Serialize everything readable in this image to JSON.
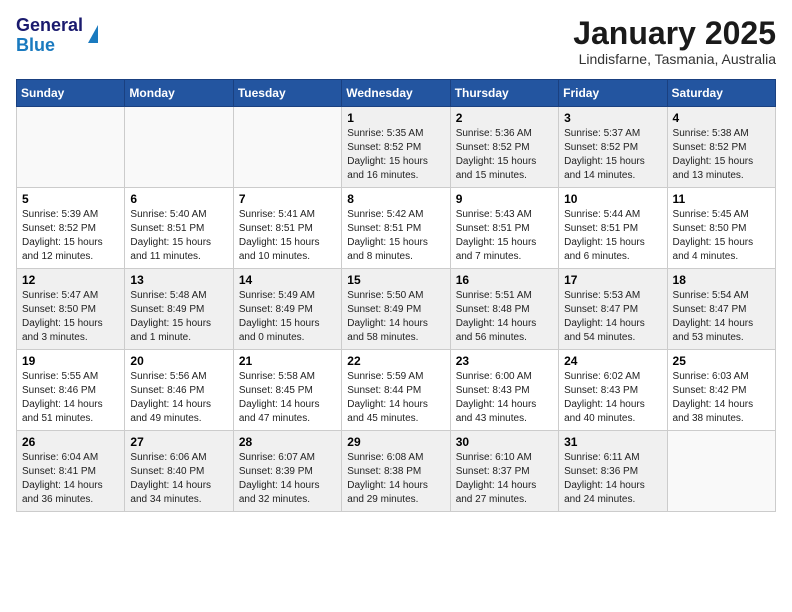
{
  "header": {
    "logo_line1": "General",
    "logo_line2": "Blue",
    "title": "January 2025",
    "subtitle": "Lindisfarne, Tasmania, Australia"
  },
  "days_of_week": [
    "Sunday",
    "Monday",
    "Tuesday",
    "Wednesday",
    "Thursday",
    "Friday",
    "Saturday"
  ],
  "weeks": [
    [
      {
        "num": "",
        "sunrise": "",
        "sunset": "",
        "daylight": ""
      },
      {
        "num": "",
        "sunrise": "",
        "sunset": "",
        "daylight": ""
      },
      {
        "num": "",
        "sunrise": "",
        "sunset": "",
        "daylight": ""
      },
      {
        "num": "1",
        "sunrise": "Sunrise: 5:35 AM",
        "sunset": "Sunset: 8:52 PM",
        "daylight": "Daylight: 15 hours and 16 minutes."
      },
      {
        "num": "2",
        "sunrise": "Sunrise: 5:36 AM",
        "sunset": "Sunset: 8:52 PM",
        "daylight": "Daylight: 15 hours and 15 minutes."
      },
      {
        "num": "3",
        "sunrise": "Sunrise: 5:37 AM",
        "sunset": "Sunset: 8:52 PM",
        "daylight": "Daylight: 15 hours and 14 minutes."
      },
      {
        "num": "4",
        "sunrise": "Sunrise: 5:38 AM",
        "sunset": "Sunset: 8:52 PM",
        "daylight": "Daylight: 15 hours and 13 minutes."
      }
    ],
    [
      {
        "num": "5",
        "sunrise": "Sunrise: 5:39 AM",
        "sunset": "Sunset: 8:52 PM",
        "daylight": "Daylight: 15 hours and 12 minutes."
      },
      {
        "num": "6",
        "sunrise": "Sunrise: 5:40 AM",
        "sunset": "Sunset: 8:51 PM",
        "daylight": "Daylight: 15 hours and 11 minutes."
      },
      {
        "num": "7",
        "sunrise": "Sunrise: 5:41 AM",
        "sunset": "Sunset: 8:51 PM",
        "daylight": "Daylight: 15 hours and 10 minutes."
      },
      {
        "num": "8",
        "sunrise": "Sunrise: 5:42 AM",
        "sunset": "Sunset: 8:51 PM",
        "daylight": "Daylight: 15 hours and 8 minutes."
      },
      {
        "num": "9",
        "sunrise": "Sunrise: 5:43 AM",
        "sunset": "Sunset: 8:51 PM",
        "daylight": "Daylight: 15 hours and 7 minutes."
      },
      {
        "num": "10",
        "sunrise": "Sunrise: 5:44 AM",
        "sunset": "Sunset: 8:51 PM",
        "daylight": "Daylight: 15 hours and 6 minutes."
      },
      {
        "num": "11",
        "sunrise": "Sunrise: 5:45 AM",
        "sunset": "Sunset: 8:50 PM",
        "daylight": "Daylight: 15 hours and 4 minutes."
      }
    ],
    [
      {
        "num": "12",
        "sunrise": "Sunrise: 5:47 AM",
        "sunset": "Sunset: 8:50 PM",
        "daylight": "Daylight: 15 hours and 3 minutes."
      },
      {
        "num": "13",
        "sunrise": "Sunrise: 5:48 AM",
        "sunset": "Sunset: 8:49 PM",
        "daylight": "Daylight: 15 hours and 1 minute."
      },
      {
        "num": "14",
        "sunrise": "Sunrise: 5:49 AM",
        "sunset": "Sunset: 8:49 PM",
        "daylight": "Daylight: 15 hours and 0 minutes."
      },
      {
        "num": "15",
        "sunrise": "Sunrise: 5:50 AM",
        "sunset": "Sunset: 8:49 PM",
        "daylight": "Daylight: 14 hours and 58 minutes."
      },
      {
        "num": "16",
        "sunrise": "Sunrise: 5:51 AM",
        "sunset": "Sunset: 8:48 PM",
        "daylight": "Daylight: 14 hours and 56 minutes."
      },
      {
        "num": "17",
        "sunrise": "Sunrise: 5:53 AM",
        "sunset": "Sunset: 8:47 PM",
        "daylight": "Daylight: 14 hours and 54 minutes."
      },
      {
        "num": "18",
        "sunrise": "Sunrise: 5:54 AM",
        "sunset": "Sunset: 8:47 PM",
        "daylight": "Daylight: 14 hours and 53 minutes."
      }
    ],
    [
      {
        "num": "19",
        "sunrise": "Sunrise: 5:55 AM",
        "sunset": "Sunset: 8:46 PM",
        "daylight": "Daylight: 14 hours and 51 minutes."
      },
      {
        "num": "20",
        "sunrise": "Sunrise: 5:56 AM",
        "sunset": "Sunset: 8:46 PM",
        "daylight": "Daylight: 14 hours and 49 minutes."
      },
      {
        "num": "21",
        "sunrise": "Sunrise: 5:58 AM",
        "sunset": "Sunset: 8:45 PM",
        "daylight": "Daylight: 14 hours and 47 minutes."
      },
      {
        "num": "22",
        "sunrise": "Sunrise: 5:59 AM",
        "sunset": "Sunset: 8:44 PM",
        "daylight": "Daylight: 14 hours and 45 minutes."
      },
      {
        "num": "23",
        "sunrise": "Sunrise: 6:00 AM",
        "sunset": "Sunset: 8:43 PM",
        "daylight": "Daylight: 14 hours and 43 minutes."
      },
      {
        "num": "24",
        "sunrise": "Sunrise: 6:02 AM",
        "sunset": "Sunset: 8:43 PM",
        "daylight": "Daylight: 14 hours and 40 minutes."
      },
      {
        "num": "25",
        "sunrise": "Sunrise: 6:03 AM",
        "sunset": "Sunset: 8:42 PM",
        "daylight": "Daylight: 14 hours and 38 minutes."
      }
    ],
    [
      {
        "num": "26",
        "sunrise": "Sunrise: 6:04 AM",
        "sunset": "Sunset: 8:41 PM",
        "daylight": "Daylight: 14 hours and 36 minutes."
      },
      {
        "num": "27",
        "sunrise": "Sunrise: 6:06 AM",
        "sunset": "Sunset: 8:40 PM",
        "daylight": "Daylight: 14 hours and 34 minutes."
      },
      {
        "num": "28",
        "sunrise": "Sunrise: 6:07 AM",
        "sunset": "Sunset: 8:39 PM",
        "daylight": "Daylight: 14 hours and 32 minutes."
      },
      {
        "num": "29",
        "sunrise": "Sunrise: 6:08 AM",
        "sunset": "Sunset: 8:38 PM",
        "daylight": "Daylight: 14 hours and 29 minutes."
      },
      {
        "num": "30",
        "sunrise": "Sunrise: 6:10 AM",
        "sunset": "Sunset: 8:37 PM",
        "daylight": "Daylight: 14 hours and 27 minutes."
      },
      {
        "num": "31",
        "sunrise": "Sunrise: 6:11 AM",
        "sunset": "Sunset: 8:36 PM",
        "daylight": "Daylight: 14 hours and 24 minutes."
      },
      {
        "num": "",
        "sunrise": "",
        "sunset": "",
        "daylight": ""
      }
    ]
  ]
}
